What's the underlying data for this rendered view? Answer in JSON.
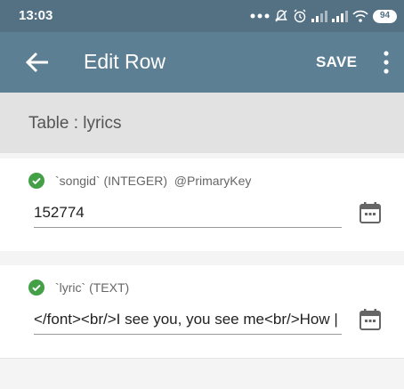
{
  "status_bar": {
    "time": "13:03",
    "battery": "94"
  },
  "app_bar": {
    "title": "Edit Row",
    "save_label": "SAVE"
  },
  "table": {
    "label": "Table : lyrics"
  },
  "rows": [
    {
      "label": "`songid` (INTEGER)  @PrimaryKey",
      "value": "152774"
    },
    {
      "label": "`lyric` (TEXT)",
      "value": "</font><br/>I see you, you see me<br/>How |"
    }
  ],
  "colors": {
    "status_bar": "#537183",
    "app_bar": "#5d7f93",
    "check": "#43a047"
  }
}
